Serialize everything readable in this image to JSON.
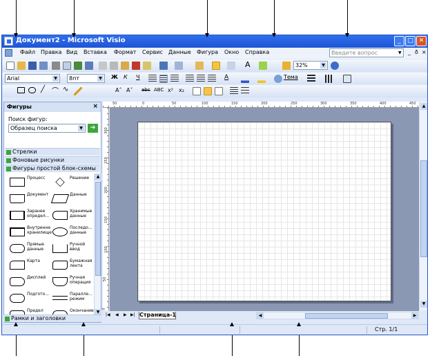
{
  "window": {
    "title": "Документ2 - Microsoft Visio",
    "minimize": "_",
    "maximize": "□",
    "close": "✕"
  },
  "menu": {
    "items": [
      "Файл",
      "Правка",
      "Вид",
      "Вставка",
      "Формат",
      "Сервис",
      "Данные",
      "Фигура",
      "Окно",
      "Справка"
    ],
    "help_placeholder": "Введите вопрос",
    "mdi_min": "_",
    "mdi_restore": "ð",
    "mdi_close": "×"
  },
  "toolbar": {
    "zoom": "32%",
    "font_name": "Arial",
    "font_size": "8пт",
    "bold": "Ж",
    "italic": "К",
    "underline": "Ч",
    "text_color_label": "A",
    "theme": "Тема",
    "grow_font": "A˄",
    "shrink_font": "A˅",
    "strike": "abc",
    "small_caps": "ABC",
    "superscript": "x²",
    "subscript": "x₂"
  },
  "shapes_panel": {
    "title": "Фигуры",
    "close": "×",
    "search_label": "Поиск фигур:",
    "search_value": "Образец поиска",
    "go": "➔",
    "stencils": [
      "Стрелки",
      "Фоновые рисунки",
      "Фигуры простой блок-схемы"
    ],
    "footer_stencil": "Рамки и заголовки",
    "shapes": [
      {
        "label": "Процесс",
        "shape": "rect"
      },
      {
        "label": "Решение",
        "shape": "diamond"
      },
      {
        "label": "Документ",
        "shape": "document"
      },
      {
        "label": "Данные",
        "shape": "parallelogram"
      },
      {
        "label": "Заранее определ...",
        "shape": "predefined"
      },
      {
        "label": "Хранимые данные",
        "shape": "stored"
      },
      {
        "label": "Внутренне хранилище",
        "shape": "internal"
      },
      {
        "label": "Последо... данные",
        "shape": "sequential"
      },
      {
        "label": "Прямые данные",
        "shape": "direct"
      },
      {
        "label": "Ручной ввод",
        "shape": "manual-input"
      },
      {
        "label": "Карта",
        "shape": "card"
      },
      {
        "label": "Бумажная лента",
        "shape": "tape"
      },
      {
        "label": "Дисплей",
        "shape": "display"
      },
      {
        "label": "Ручная операция",
        "shape": "manual-op"
      },
      {
        "label": "Подгото...",
        "shape": "preparation"
      },
      {
        "label": "Паралле... режим",
        "shape": "parallel"
      },
      {
        "label": "Предел",
        "shape": "loop-limit"
      },
      {
        "label": "Окончание",
        "shape": "terminator"
      }
    ]
  },
  "ruler": {
    "h_labels": [
      "50",
      "0",
      "50",
      "100",
      "150",
      "200",
      "250",
      "300",
      "350",
      "400",
      "450"
    ],
    "v_labels": [
      "300",
      "250",
      "200",
      "150",
      "100",
      "50",
      "0"
    ]
  },
  "tabs": {
    "page_tab": "Страница-1"
  },
  "status": {
    "page": "Стр. 1/1"
  }
}
